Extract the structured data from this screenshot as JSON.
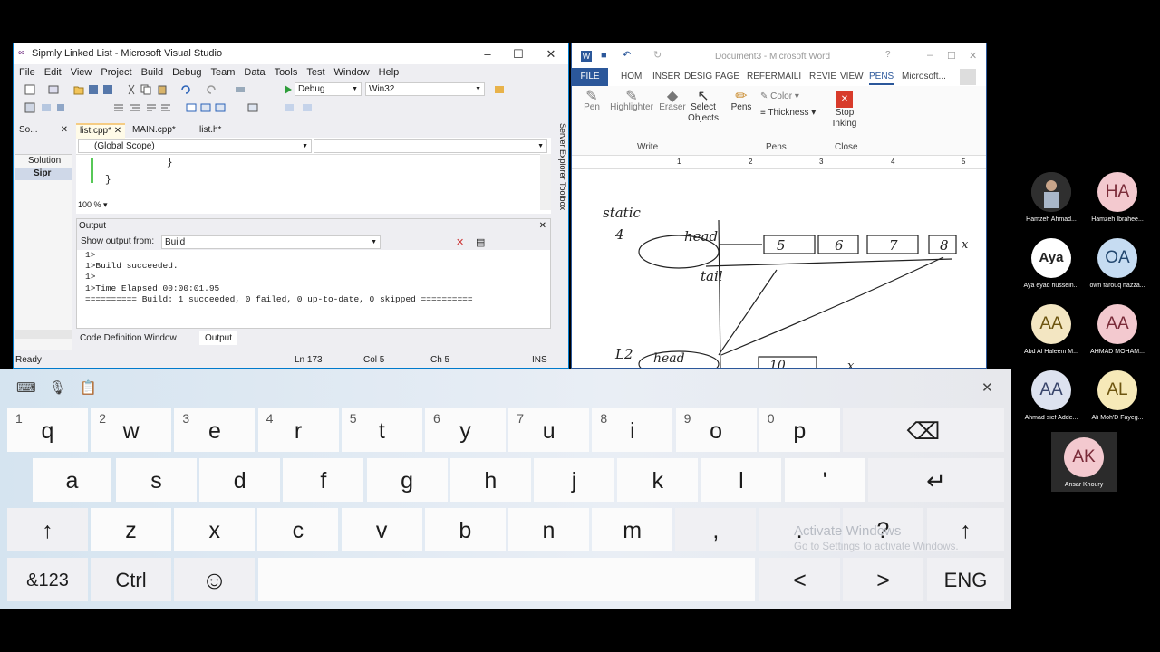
{
  "vs": {
    "title": "Sipmly Linked List - Microsoft Visual Studio",
    "menu": [
      "File",
      "Edit",
      "View",
      "Project",
      "Build",
      "Debug",
      "Team",
      "Data",
      "Tools",
      "Test",
      "Window",
      "Help"
    ],
    "config": "Debug",
    "platform": "Win32",
    "solution_panel": {
      "title": "So...",
      "item_solution": "Solution",
      "item_project": "Sipr"
    },
    "tabs": [
      "list.cpp*",
      "MAIN.cpp*",
      "list.h*"
    ],
    "scope": "(Global Scope)",
    "code_lines": [
      "}",
      "}"
    ],
    "zoom": "100 %",
    "output": {
      "title": "Output",
      "show_label": "Show output from:",
      "source": "Build",
      "lines": [
        "1>",
        "1>Build succeeded.",
        "1>",
        "1>Time Elapsed 00:00:01.95",
        "========== Build: 1 succeeded, 0 failed, 0 up-to-date, 0 skipped =========="
      ]
    },
    "bottom_tabs": [
      "Code Definition Window",
      "Output"
    ],
    "side_tabs": [
      "Server Explorer",
      "Toolbox"
    ],
    "status": {
      "ready": "Ready",
      "ln": "Ln 173",
      "col": "Col 5",
      "ch": "Ch 5",
      "ins": "INS"
    }
  },
  "word": {
    "title": "Document3 - Microsoft Word",
    "tabs": [
      "FILE",
      "HOM",
      "INSER",
      "DESIG",
      "PAGE",
      "REFER",
      "MAILI",
      "REVIE",
      "VIEW",
      "PENS"
    ],
    "account": "Microsoft...",
    "ribbon": {
      "pen": "Pen",
      "highlighter": "Highlighter",
      "eraser": "Eraser",
      "select_objects": "Select Objects",
      "pens": "Pens",
      "color": "Color",
      "thickness": "Thickness",
      "stop_inking": "Stop Inking",
      "group_write": "Write",
      "group_pens": "Pens",
      "group_close": "Close"
    },
    "ruler": [
      "1",
      "2",
      "3",
      "4",
      "5"
    ],
    "ink": {
      "static": "static",
      "four": "4",
      "head": "head",
      "tail": "tail",
      "l2": "L2",
      "nodes": [
        "5",
        "6",
        "7",
        "8"
      ],
      "x": "x",
      "bottom_node": "10"
    }
  },
  "keyboard": {
    "row1": [
      {
        "k": "q",
        "h": "1"
      },
      {
        "k": "w",
        "h": "2"
      },
      {
        "k": "e",
        "h": "3"
      },
      {
        "k": "r",
        "h": "4"
      },
      {
        "k": "t",
        "h": "5"
      },
      {
        "k": "y",
        "h": "6"
      },
      {
        "k": "u",
        "h": "7"
      },
      {
        "k": "i",
        "h": "8"
      },
      {
        "k": "o",
        "h": "9"
      },
      {
        "k": "p",
        "h": "0"
      }
    ],
    "row2": [
      "a",
      "s",
      "d",
      "f",
      "g",
      "h",
      "j",
      "k",
      "l",
      "'"
    ],
    "row3": [
      "z",
      "x",
      "c",
      "v",
      "b",
      "n",
      "m",
      ",",
      ".",
      "?"
    ],
    "num_key": "&123",
    "ctrl_key": "Ctrl",
    "lang_key": "ENG",
    "backspace": "⌫",
    "enter": "↵",
    "shift": "↑",
    "left": "<",
    "right": ">",
    "emoji": "☺",
    "close": "✕"
  },
  "watermark": {
    "line1": "Activate Windows",
    "line2": "Go to Settings to activate Windows."
  },
  "participants": [
    {
      "initials": "",
      "name": "Hamzeh Ahmad...",
      "bg": "#3a3a3a",
      "fg": "#fff"
    },
    {
      "initials": "HA",
      "name": "Hamzeh Ibrahee...",
      "bg": "#f3c9cf",
      "fg": "#7a2b39"
    },
    {
      "initials": "Aya",
      "name": "Aya eyad hussein...",
      "bg": "#ffffff",
      "fg": "#222"
    },
    {
      "initials": "OA",
      "name": "own farouq hazza...",
      "bg": "#c6dcf2",
      "fg": "#22476f"
    },
    {
      "initials": "AA",
      "name": "Abd Al Haleem M...",
      "bg": "#f3e6c2",
      "fg": "#6d5510"
    },
    {
      "initials": "AA",
      "name": "AHMAD MOHAM...",
      "bg": "#f3c9cf",
      "fg": "#7a2b39"
    },
    {
      "initials": "AA",
      "name": "Ahmad sief Adde...",
      "bg": "#dde2ef",
      "fg": "#39456b"
    },
    {
      "initials": "AL",
      "name": "Ali Moh'D Fayeg...",
      "bg": "#f6e9b8",
      "fg": "#6d5510"
    },
    {
      "initials": "AK",
      "name": "Ansar Khoury",
      "bg": "#f3c9cf",
      "fg": "#7a2b39"
    }
  ]
}
